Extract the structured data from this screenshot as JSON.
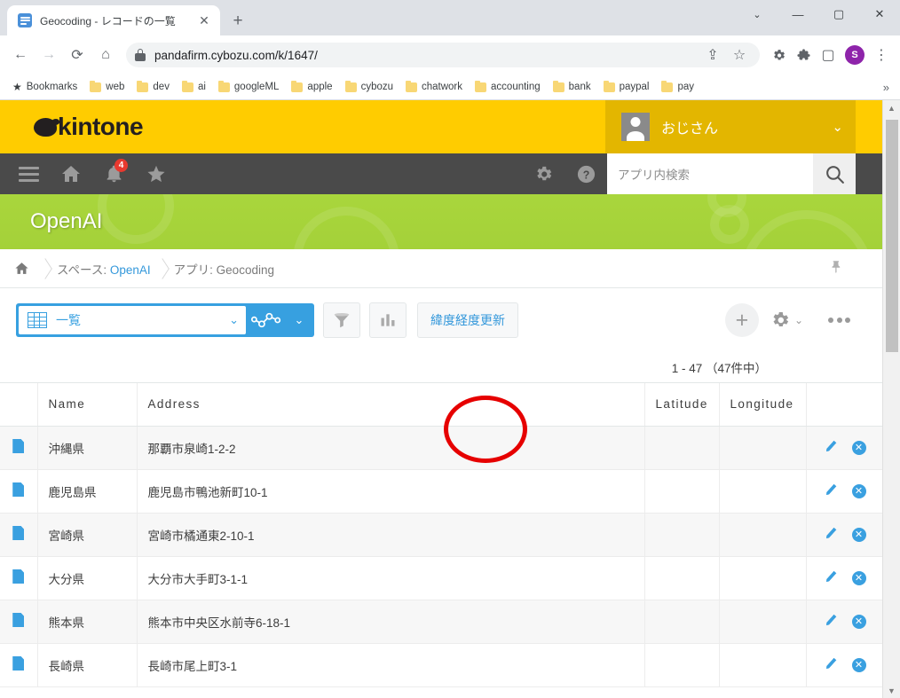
{
  "browser": {
    "tab": {
      "title": "Geocoding - レコードの一覧",
      "close_label": "✕",
      "favicon": "document-list-icon"
    },
    "new_tab_label": "+",
    "window_controls": {
      "restore_group": "⌄",
      "minimize": "—",
      "maximize": "▢",
      "close": "✕"
    },
    "nav": {
      "back": "←",
      "forward": "→",
      "reload": "⟳",
      "home": "⌂"
    },
    "omnibox": {
      "url": "pandafirm.cybozu.com/k/1647/",
      "lock": "lock-icon"
    },
    "omnibox_actions": {
      "share": "⇪",
      "bookmark": "☆",
      "puzzle": "extensions-icon",
      "gear": "settings-icon",
      "sidepanel": "▢",
      "profile_initial": "S",
      "menu": "⋮"
    },
    "bookmarks": {
      "star_label": "Bookmarks",
      "items": [
        "web",
        "dev",
        "ai",
        "googleML",
        "apple",
        "cybozu",
        "chatwork",
        "accounting",
        "bank",
        "paypal",
        "pay"
      ],
      "overflow": "»"
    }
  },
  "kintone": {
    "logo_text": "kintone",
    "user": {
      "name": "おじさん",
      "chevron": "⌄"
    },
    "nav": {
      "menu": "menu-icon",
      "home": "home-icon",
      "bell": "notification-icon",
      "bell_badge": "4",
      "star": "favorites-icon",
      "gear": "settings-icon",
      "help": "?"
    },
    "search": {
      "placeholder": "アプリ内検索",
      "button": "search-icon"
    },
    "space": {
      "title": "OpenAI"
    },
    "breadcrumb": {
      "home": "home-icon",
      "space_prefix": "スペース: ",
      "space_name": "OpenAI",
      "app": "アプリ: Geocoding",
      "pin": "pin-icon"
    },
    "toolbar": {
      "view_name": "一覧",
      "view_chevron": "⌄",
      "graph_chevron": "⌄",
      "filter_icon": "filter-icon",
      "chart_icon": "chart-icon",
      "custom_button": "緯度経度更新",
      "add_label": "+",
      "gear_chevron": "⌄"
    },
    "record_count": "1 - 47 （47件中）",
    "table": {
      "columns": [
        "Name",
        "Address",
        "Latitude",
        "Longitude"
      ],
      "rows": [
        {
          "name": "沖縄県",
          "address": "那覇市泉崎1-2-2",
          "latitude": "",
          "longitude": ""
        },
        {
          "name": "鹿児島県",
          "address": "鹿児島市鴨池新町10-1",
          "latitude": "",
          "longitude": ""
        },
        {
          "name": "宮崎県",
          "address": "宮崎市橘通東2-10-1",
          "latitude": "",
          "longitude": ""
        },
        {
          "name": "大分県",
          "address": "大分市大手町3-1-1",
          "latitude": "",
          "longitude": ""
        },
        {
          "name": "熊本県",
          "address": "熊本市中央区水前寺6-18-1",
          "latitude": "",
          "longitude": ""
        },
        {
          "name": "長崎県",
          "address": "長崎市尾上町3-1",
          "latitude": "",
          "longitude": ""
        }
      ],
      "row_actions": {
        "edit": "edit-icon",
        "delete": "✕"
      }
    },
    "colors": {
      "header_yellow": "#ffcc00",
      "user_yellow": "#e3b600",
      "nav_dark": "#4a4a4a",
      "space_green": "#a9d63c",
      "accent_blue": "#37a0e0",
      "badge_red": "#e8392f",
      "annotation_red": "#e60000"
    }
  }
}
